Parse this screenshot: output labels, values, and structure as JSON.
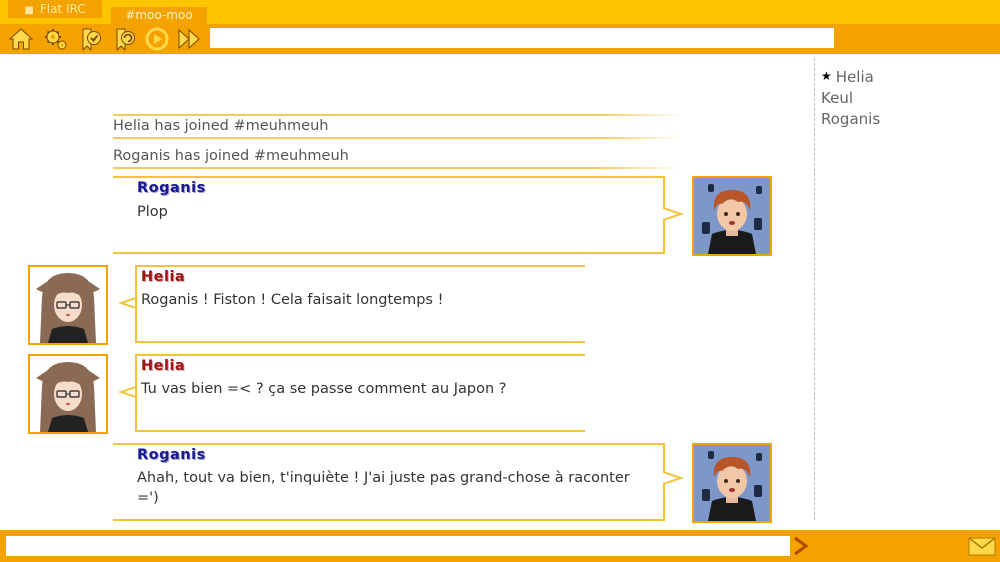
{
  "tabs": [
    {
      "label": "Flat IRC",
      "icon": "chat-bubble-icon"
    },
    {
      "label": "#moo-moo",
      "active": true
    }
  ],
  "toolbar": {
    "icons": [
      "home-icon",
      "settings-gears-icon",
      "bookmark-check-icon",
      "bookmark-refresh-icon",
      "play-circle-icon",
      "fast-forward-icon"
    ],
    "topic_value": ""
  },
  "system_messages": [
    "Helia has joined #meuhmeuh",
    "Roganis has joined #meuhmeuh"
  ],
  "messages": [
    {
      "nick": "Roganis",
      "text": "Plop",
      "side": "right"
    },
    {
      "nick": "Helia",
      "text": "Roganis ! Fiston ! Cela faisait longtemps !",
      "side": "left"
    },
    {
      "nick": "Helia",
      "text": "Tu vas bien =< ? ça se passe comment au Japon ?",
      "side": "left"
    },
    {
      "nick": "Roganis",
      "text": "Ahah, tout va bien, t'inquiète ! J'ai juste pas grand-chose à raconter =')",
      "side": "right"
    }
  ],
  "users": [
    {
      "name": "Helia",
      "op": true
    },
    {
      "name": "Keul",
      "op": false
    },
    {
      "name": "Roganis",
      "op": false
    }
  ],
  "input": {
    "value": "",
    "placeholder": ""
  },
  "colors": {
    "bar_orange": "#f4a200",
    "bar_yellow": "#ffc400",
    "bubble_border": "#f4c23a",
    "nick_roganis": "#1a1a8c",
    "nick_helia": "#9a1414"
  }
}
